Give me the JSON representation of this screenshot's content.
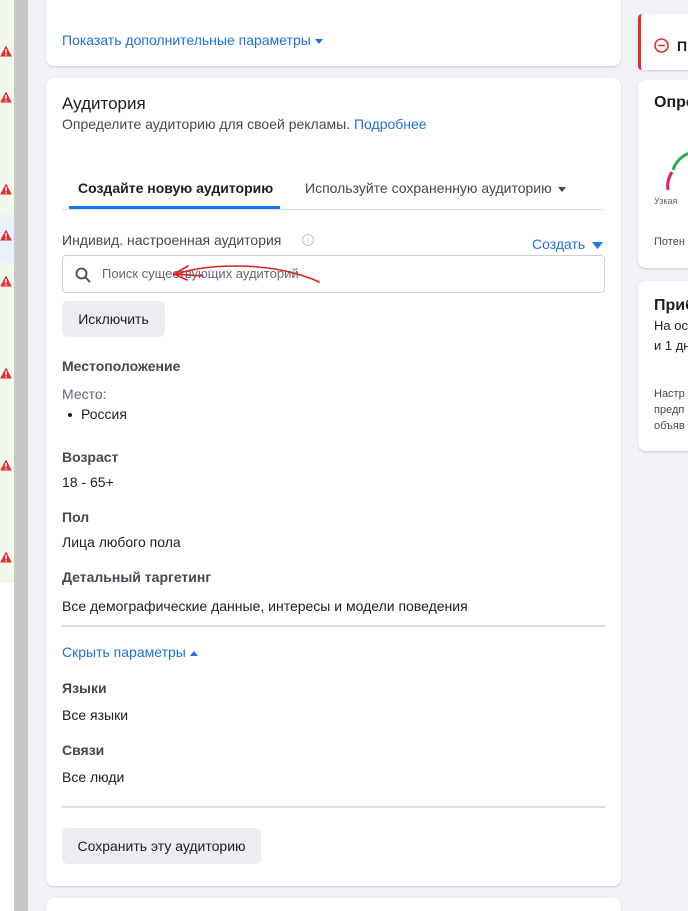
{
  "advanced": {
    "show_more_label": "Показать дополнительные параметры"
  },
  "audience": {
    "title": "Аудитория",
    "description": "Определите аудиторию для своей рекламы.",
    "learn_more": "Подробнее",
    "tabs": [
      {
        "label": "Создайте новую аудиторию",
        "active": true
      },
      {
        "label": "Используйте сохраненную аудиторию",
        "active": false
      }
    ],
    "custom_audience_label": "Индивид. настроенная аудитория",
    "create_label": "Создать",
    "search_placeholder": "Поиск существующих аудиторий",
    "exclude_button": "Исключить",
    "location": {
      "title": "Местоположение",
      "place_label": "Место:",
      "places": [
        "Россия"
      ]
    },
    "age": {
      "title": "Возраст",
      "value": "18 - 65+"
    },
    "gender": {
      "title": "Пол",
      "value": "Лица любого пола"
    },
    "detailed": {
      "title": "Детальный таргетинг",
      "value": "Все демографические данные, интересы и модели поведения"
    },
    "hide_params": "Скрыть параметры",
    "languages": {
      "title": "Языки",
      "value": "Все языки"
    },
    "connections": {
      "title": "Связи",
      "value": "Все люди"
    },
    "save_button": "Сохранить эту аудиторию"
  },
  "right_panel": {
    "alert_text": "П",
    "definition_title": "Опре",
    "gauge_left_label": "Узкая",
    "potential_label": "Потен",
    "estimate_title": "Приб",
    "estimate_line1": "На ос",
    "estimate_line2": "и 1 дн",
    "note_line1": "Настр",
    "note_line2": "предп",
    "note_line3": "объяв"
  },
  "colors": {
    "accent": "#1877f2",
    "link": "#216fdb",
    "warning": "#e02e2e",
    "gauge_red": "#e0245e",
    "gauge_green": "#2fa84f"
  },
  "icons": {
    "search": "search-icon",
    "info": "info-icon",
    "warning": "warning-icon",
    "alert": "minus-circle-icon"
  }
}
